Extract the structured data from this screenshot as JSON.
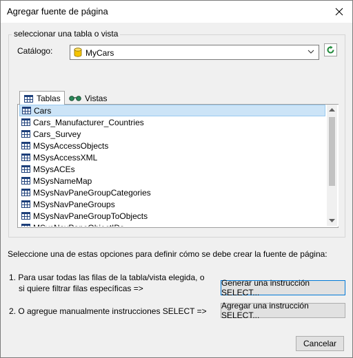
{
  "window": {
    "title": "Agregar fuente de página"
  },
  "group": {
    "legend": "seleccionar una tabla o vista"
  },
  "catalog": {
    "label": "Catálogo:",
    "value": "MyCars"
  },
  "tabs": [
    {
      "label": "Tablas",
      "icon": "table-icon",
      "active": true
    },
    {
      "label": "Vistas",
      "icon": "glasses-icon",
      "active": false
    }
  ],
  "tables": [
    {
      "label": "Cars",
      "selected": true
    },
    {
      "label": "Cars_Manufacturer_Countries"
    },
    {
      "label": "Cars_Survey"
    },
    {
      "label": "MSysAccessObjects"
    },
    {
      "label": "MSysAccessXML"
    },
    {
      "label": "MSysACEs"
    },
    {
      "label": "MSysNameMap"
    },
    {
      "label": "MSysNavPaneGroupCategories"
    },
    {
      "label": "MSysNavPaneGroups"
    },
    {
      "label": "MSysNavPaneGroupToObjects"
    },
    {
      "label": "MSysNavPaneObjectIDs"
    }
  ],
  "instructions": "Seleccione una de estas opciones para definir cómo se debe crear la fuente de página:",
  "option1": {
    "line1": "1. Para usar todas las filas de la tabla/vista elegida, o",
    "line2": "si quiere filtrar filas específicas =>",
    "button": "Generar una instrucción SELECT..."
  },
  "option2": {
    "line": "2. O agregue manualmente instrucciones SELECT =>",
    "button": "Agregar una instrucción SELECT..."
  },
  "cancel": "Cancelar",
  "colors": {
    "selection": "#cce4f7",
    "dialog_bg": "#f0f0f0",
    "focus_border": "#0078d7",
    "refresh_green": "#1f8a3a"
  }
}
